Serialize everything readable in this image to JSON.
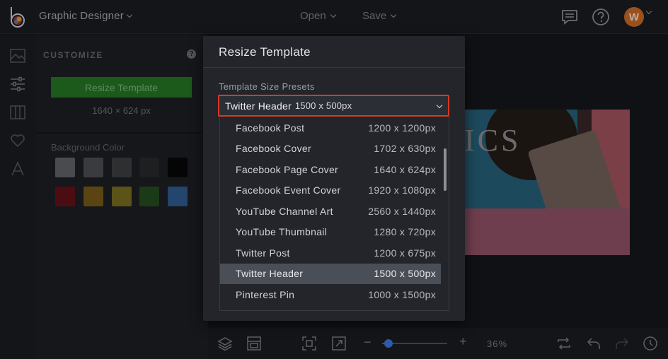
{
  "topbar": {
    "app_title": "Graphic Designer",
    "open_label": "Open",
    "save_label": "Save",
    "avatar_initial": "W"
  },
  "panel": {
    "title": "CUSTOMIZE",
    "help_glyph": "?",
    "resize_button": "Resize Template",
    "current_size": "1640 × 624 px",
    "background_label": "Background Color",
    "swatches": [
      "#4a4b4e",
      "#3a3b3e",
      "#2e2f31",
      "#1e1f21",
      "#050505",
      "#4b0d12",
      "#5a4512",
      "#5b5317",
      "#1b3a16",
      "#23456e"
    ]
  },
  "canvas": {
    "art_text": "ICS"
  },
  "bottombar": {
    "zoom_minus": "−",
    "zoom_plus": "+",
    "zoom_level": "36%",
    "zoom_fraction": 0.1
  },
  "modal": {
    "title": "Resize Template",
    "preset_label": "Template Size Presets",
    "selected_name": "Twitter Header",
    "selected_size": "1500 x 500px",
    "options": [
      {
        "name": "Facebook Post",
        "size": "1200 x 1200px"
      },
      {
        "name": "Facebook Cover",
        "size": "1702 x 630px"
      },
      {
        "name": "Facebook Page Cover",
        "size": "1640 x 624px"
      },
      {
        "name": "Facebook Event Cover",
        "size": "1920 x 1080px"
      },
      {
        "name": "YouTube Channel Art",
        "size": "2560 x 1440px"
      },
      {
        "name": "YouTube Thumbnail",
        "size": "1280 x 720px"
      },
      {
        "name": "Twitter Post",
        "size": "1200 x 675px"
      },
      {
        "name": "Twitter Header",
        "size": "1500 x 500px"
      },
      {
        "name": "Pinterest Pin",
        "size": "1000 x 1500px"
      }
    ],
    "selected_index": 7
  },
  "colors": {
    "accent_highlight": "#d63a22",
    "primary_green": "#1c5a1c",
    "avatar": "#c8661e",
    "zoom_thumb": "#2f5aa8"
  },
  "icons": {
    "rail": [
      "image-icon",
      "sliders-icon",
      "columns-icon",
      "heart-icon",
      "text-icon"
    ],
    "bottom": [
      "layers-icon",
      "template-icon",
      "fit-screen-icon",
      "expand-icon",
      "swap-icon",
      "undo-icon",
      "redo-icon",
      "history-icon"
    ]
  }
}
